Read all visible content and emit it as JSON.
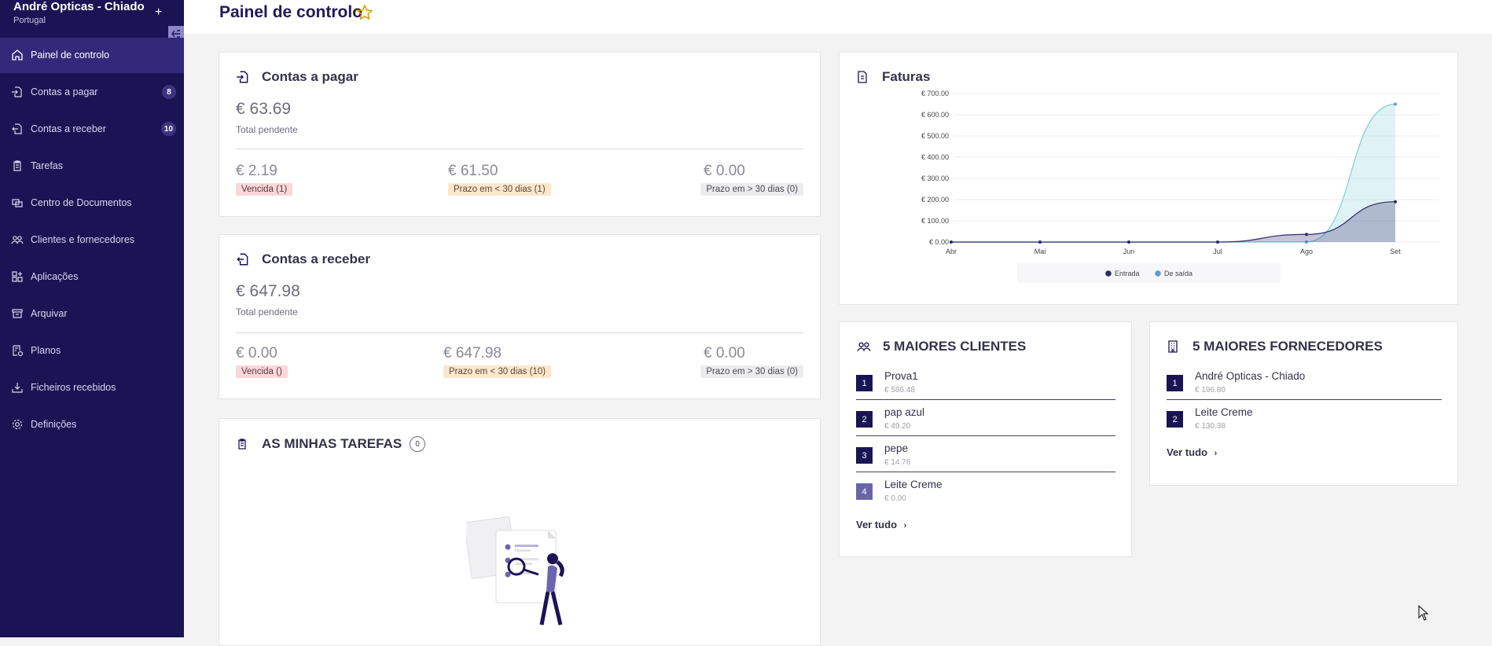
{
  "org": {
    "name": "André Opticas - Chiado",
    "country": "Portugal"
  },
  "nav": [
    {
      "label": "Painel de controlo",
      "icon": "home-icon",
      "active": true
    },
    {
      "label": "Contas a pagar",
      "icon": "file-import-icon",
      "badge": "8"
    },
    {
      "label": "Contas a receber",
      "icon": "file-export-icon",
      "badge": "10"
    },
    {
      "label": "Tarefas",
      "icon": "clipboard-icon"
    },
    {
      "label": "Centro de Documentos",
      "icon": "documents-icon"
    },
    {
      "label": "Clientes e fornecedores",
      "icon": "users-icon"
    },
    {
      "label": "Aplicações",
      "icon": "apps-icon"
    },
    {
      "label": "Arquivar",
      "icon": "archive-icon"
    },
    {
      "label": "Planos",
      "icon": "plans-icon"
    },
    {
      "label": "Ficheiros recebidos",
      "icon": "download-icon"
    },
    {
      "label": "Definições",
      "icon": "gear-icon"
    }
  ],
  "page": {
    "title": "Painel de controlo"
  },
  "payables": {
    "title": "Contas a pagar",
    "total": "€ 63.69",
    "total_label": "Total pendente",
    "overdue": {
      "amount": "€ 2.19",
      "label": "Vencida (1)"
    },
    "due_soon": {
      "amount": "€ 61.50",
      "label": "Prazo em < 30 dias (1)"
    },
    "due_later": {
      "amount": "€ 0.00",
      "label": "Prazo em > 30 dias (0)"
    }
  },
  "receivables": {
    "title": "Contas a receber",
    "total": "€ 647.98",
    "total_label": "Total pendente",
    "overdue": {
      "amount": "€ 0.00",
      "label": "Vencida ()"
    },
    "due_soon": {
      "amount": "€ 647.98",
      "label": "Prazo em < 30 dias (10)"
    },
    "due_later": {
      "amount": "€ 0.00",
      "label": "Prazo em > 30 dias (0)"
    }
  },
  "tasks": {
    "title": "AS MINHAS TAREFAS",
    "count": "0"
  },
  "invoices": {
    "title": "Faturas"
  },
  "chart_data": {
    "type": "area",
    "categories": [
      "Abr",
      "Mai",
      "Jun",
      "Jul",
      "Ago",
      "Set"
    ],
    "series": [
      {
        "name": "Entrada",
        "color": "#2e2a6e",
        "values": [
          0,
          0,
          0,
          0,
          36,
          190
        ]
      },
      {
        "name": "De saída",
        "color": "#5b9ec9",
        "values": [
          0,
          0,
          0,
          0,
          0,
          650
        ]
      }
    ],
    "y_ticks": [
      "€ 0.00",
      "€ 100.00",
      "€ 200.00",
      "€ 300.00",
      "€ 400.00",
      "€ 500.00",
      "€ 600.00",
      "€ 700.00"
    ],
    "ylim": [
      0,
      700
    ],
    "grid": true,
    "legend": "bottom"
  },
  "top_clients": {
    "title": "5 MAIORES CLIENTES",
    "view_all": "Ver tudo",
    "items": [
      {
        "rank": "1",
        "name": "Prova1",
        "value": "€ 586.48"
      },
      {
        "rank": "2",
        "name": "pap azul",
        "value": "€ 49.20"
      },
      {
        "rank": "3",
        "name": "pepe",
        "value": "€ 14.76"
      },
      {
        "rank": "4",
        "name": "Leite Creme",
        "value": "€ 0.00"
      }
    ]
  },
  "top_suppliers": {
    "title": "5 MAIORES FORNECEDORES",
    "view_all": "Ver tudo",
    "items": [
      {
        "rank": "1",
        "name": "André Opticas - Chiado",
        "value": "€ 196.80"
      },
      {
        "rank": "2",
        "name": "Leite Creme",
        "value": "€ 130.38"
      }
    ]
  }
}
